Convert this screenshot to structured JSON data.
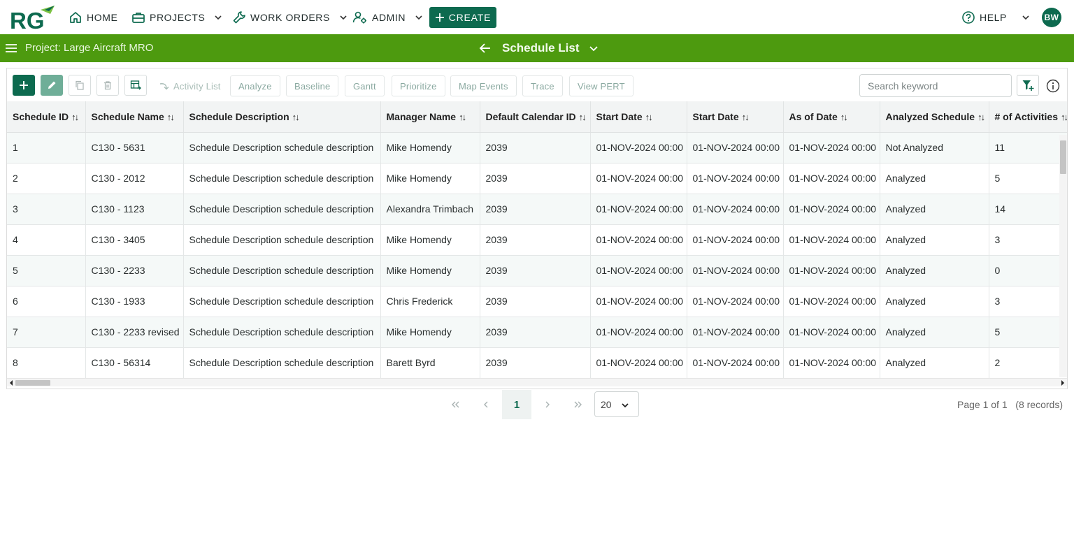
{
  "topnav": {
    "logo_text": "RG",
    "home": "HOME",
    "projects": "PROJECTS",
    "work_orders": "WORK ORDERS",
    "admin": "ADMIN",
    "create": "CREATE",
    "help": "HELP",
    "avatar_initials": "BW"
  },
  "project_bar": {
    "project_label": "Project: Large Aircraft MRO",
    "page_title": "Schedule List"
  },
  "toolbar": {
    "activity_list": "Activity List",
    "analyze": "Analyze",
    "baseline": "Baseline",
    "gantt": "Gantt",
    "prioritize": "Prioritize",
    "map_events": "Map Events",
    "trace": "Trace",
    "view_pert": "View PERT",
    "search_placeholder": "Search keyword"
  },
  "table": {
    "columns": [
      "Schedule ID",
      "Schedule Name",
      "Schedule Description",
      "Manager Name",
      "Default Calendar ID",
      "Start Date",
      "Start Date",
      "As of Date",
      "Analyzed Schedule",
      "# of Activities"
    ],
    "rows": [
      [
        "1",
        "C130 - 5631",
        "Schedule Description schedule description",
        "Mike Homendy",
        "2039",
        "01-NOV-2024 00:00",
        "01-NOV-2024 00:00",
        "01-NOV-2024 00:00",
        "Not Analyzed",
        "11"
      ],
      [
        "2",
        "C130 - 2012",
        "Schedule Description schedule description",
        "Mike Homendy",
        "2039",
        "01-NOV-2024 00:00",
        "01-NOV-2024 00:00",
        "01-NOV-2024 00:00",
        "Analyzed",
        "5"
      ],
      [
        "3",
        "C130 - 1123",
        "Schedule Description schedule description",
        "Alexandra Trimbach",
        "2039",
        "01-NOV-2024 00:00",
        "01-NOV-2024 00:00",
        "01-NOV-2024 00:00",
        "Analyzed",
        "14"
      ],
      [
        "4",
        "C130 - 3405",
        "Schedule Description schedule description",
        "Mike Homendy",
        "2039",
        "01-NOV-2024 00:00",
        "01-NOV-2024 00:00",
        "01-NOV-2024 00:00",
        "Analyzed",
        "3"
      ],
      [
        "5",
        "C130 - 2233",
        "Schedule Description schedule description",
        "Mike Homendy",
        "2039",
        "01-NOV-2024 00:00",
        "01-NOV-2024 00:00",
        "01-NOV-2024 00:00",
        "Analyzed",
        "0"
      ],
      [
        "6",
        "C130 - 1933",
        "Schedule Description schedule description",
        "Chris Frederick",
        "2039",
        "01-NOV-2024 00:00",
        "01-NOV-2024 00:00",
        "01-NOV-2024 00:00",
        "Analyzed",
        "3"
      ],
      [
        "7",
        "C130 - 2233 revised",
        "Schedule Description schedule description",
        "Mike Homendy",
        "2039",
        "01-NOV-2024 00:00",
        "01-NOV-2024 00:00",
        "01-NOV-2024 00:00",
        "Analyzed",
        "5"
      ],
      [
        "8",
        "C130 - 56314",
        "Schedule Description schedule description",
        "Barett Byrd",
        "2039",
        "01-NOV-2024 00:00",
        "01-NOV-2024 00:00",
        "01-NOV-2024 00:00",
        "Analyzed",
        "2"
      ]
    ]
  },
  "pagination": {
    "current_page": "1",
    "page_size": "20",
    "page_info": "Page 1 of 1",
    "records_info": "(8 records)"
  },
  "icons": {
    "home": "home-icon",
    "projects": "briefcase-icon",
    "work_orders": "wrench-icon",
    "admin": "user-gear-icon",
    "help": "help-circle-icon",
    "menu": "hamburger-icon",
    "back": "arrow-left-icon",
    "add": "plus-icon",
    "edit": "pencil-icon",
    "copy": "copy-icon",
    "delete": "trash-icon",
    "export": "table-export-icon",
    "activity_list": "curved-arrow-icon",
    "filter": "filter-plus-icon",
    "info": "info-icon"
  },
  "colors": {
    "brand_green": "#0d6a4f",
    "project_bar": "#4d9a0f",
    "header_bg": "#f2f4f4",
    "row_alt": "#f5f9f8"
  }
}
